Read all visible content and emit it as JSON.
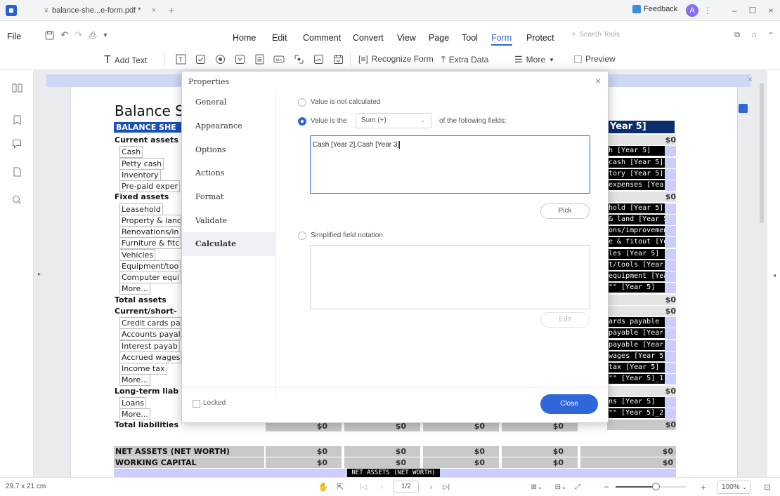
{
  "window": {
    "tab_title": "balance-she...e-form.pdf *",
    "feedback": "Feedback",
    "avatar_letter": "A"
  },
  "menu": {
    "file": "File",
    "items": [
      "Home",
      "Edit",
      "Comment",
      "Convert",
      "View",
      "Page",
      "Tool",
      "Form",
      "Protect"
    ],
    "active": "Form",
    "search_placeholder": "Search Tools"
  },
  "form_toolbar": {
    "add_text": "Add Text",
    "recognize_form": "Recognize Form",
    "extra_data": "Extra Data",
    "more": "More",
    "preview": "Preview"
  },
  "document": {
    "title": "Balance S",
    "header_left": "BALANCE SHE",
    "header_right": "Year 5]",
    "rows_left": [
      {
        "text": "Current assets",
        "bold": true
      },
      {
        "text": "Cash",
        "bold": false
      },
      {
        "text": "Petty cash",
        "bold": false
      },
      {
        "text": "Inventory",
        "bold": false
      },
      {
        "text": "Pre-paid exper",
        "bold": false
      },
      {
        "text": "Fixed assets",
        "bold": true
      },
      {
        "text": "Leasehold",
        "bold": false
      },
      {
        "text": "Property & lanc",
        "bold": false
      },
      {
        "text": "Renovations/in",
        "bold": false
      },
      {
        "text": "Furniture & fitc",
        "bold": false
      },
      {
        "text": "Vehicles",
        "bold": false
      },
      {
        "text": "Equipment/too",
        "bold": false
      },
      {
        "text": "Computer equi",
        "bold": false
      },
      {
        "text": "More...",
        "bold": false
      },
      {
        "text": "Total assets",
        "bold": true
      },
      {
        "text": "Current/short-",
        "bold": true
      },
      {
        "text": "Credit cards pa",
        "bold": false
      },
      {
        "text": "Accounts payal",
        "bold": false
      },
      {
        "text": "Interest payab",
        "bold": false
      },
      {
        "text": "Accrued wages",
        "bold": false
      },
      {
        "text": "Income tax",
        "bold": false
      },
      {
        "text": "More...",
        "bold": false
      },
      {
        "text": "Long-term liab",
        "bold": true
      },
      {
        "text": "Loans",
        "bold": false
      },
      {
        "text": "More...",
        "bold": false
      },
      {
        "text": "Total liabilities",
        "bold": true
      }
    ],
    "rows_right": [
      {
        "text": "$0",
        "type": "amount"
      },
      {
        "text": "h [Year 5]",
        "type": "field"
      },
      {
        "text": "cash [Year 5]",
        "type": "field"
      },
      {
        "text": "tory [Year 5]",
        "type": "field"
      },
      {
        "text": "expenses [Year",
        "type": "field"
      },
      {
        "text": "$0",
        "type": "amount"
      },
      {
        "text": "hold [Year 5]",
        "type": "field"
      },
      {
        "text": "& land [Year 5",
        "type": "field"
      },
      {
        "text": "ons/improvement",
        "type": "field"
      },
      {
        "text": "e & fitout [Yea",
        "type": "field"
      },
      {
        "text": "les [Year 5]",
        "type": "field"
      },
      {
        "text": "t/tools [Year 5",
        "type": "field"
      },
      {
        "text": "equipment [Yea",
        "type": "field"
      },
      {
        "text": "\"\" [Year 5]",
        "type": "field"
      },
      {
        "text": "$0",
        "type": "amount"
      },
      {
        "text": "$0",
        "type": "amount"
      },
      {
        "text": "ards payable [Y",
        "type": "field"
      },
      {
        "text": "payable [Year",
        "type": "field"
      },
      {
        "text": "payable [Year",
        "type": "field"
      },
      {
        "text": "wages [Year 5]",
        "type": "field"
      },
      {
        "text": "tax [Year 5]",
        "type": "field"
      },
      {
        "text": "\"\" [Year 5]_1",
        "type": "field"
      },
      {
        "text": "$0",
        "type": "amount"
      },
      {
        "text": "ns [Year 5]",
        "type": "field"
      },
      {
        "text": "\"\" [Year 5]_2",
        "type": "field"
      },
      {
        "text": "$0",
        "type": "amount"
      }
    ],
    "total_liabilities_values": [
      "$0",
      "$0",
      "$0",
      "$0"
    ],
    "net_assets_label": "NET ASSETS (NET WORTH)",
    "working_capital_label": "WORKING CAPITAL",
    "net_assets_values": [
      "$0",
      "$0",
      "$0",
      "$0",
      "$0"
    ],
    "working_capital_values": [
      "$0",
      "$0",
      "$0",
      "$0",
      "$0"
    ],
    "bottom_field": "NET ASSETS (NET WORTH)"
  },
  "dialog": {
    "title": "Properties",
    "nav": [
      "General",
      "Appearance",
      "Options",
      "Actions",
      "Format",
      "Validate",
      "Calculate"
    ],
    "active_nav": "Calculate",
    "opt_not_calculated": "Value is not calculated",
    "opt_value_is_the": "Value is the",
    "operation": "Sum (+)",
    "of_following": "of the following fields:",
    "fields_value": "Cash [Year 2],Cash [Year 3]",
    "pick": "Pick",
    "opt_simplified": "Simplified field notation",
    "edit": "Edit",
    "locked": "Locked",
    "close": "Close"
  },
  "status": {
    "page_size": "29.7 x 21 cm",
    "page_indicator": "1/2",
    "zoom": "100%"
  },
  "colors": {
    "accent": "#2f66d8",
    "doc_header": "#1a4fb5",
    "field_blue": "#ccccff"
  }
}
